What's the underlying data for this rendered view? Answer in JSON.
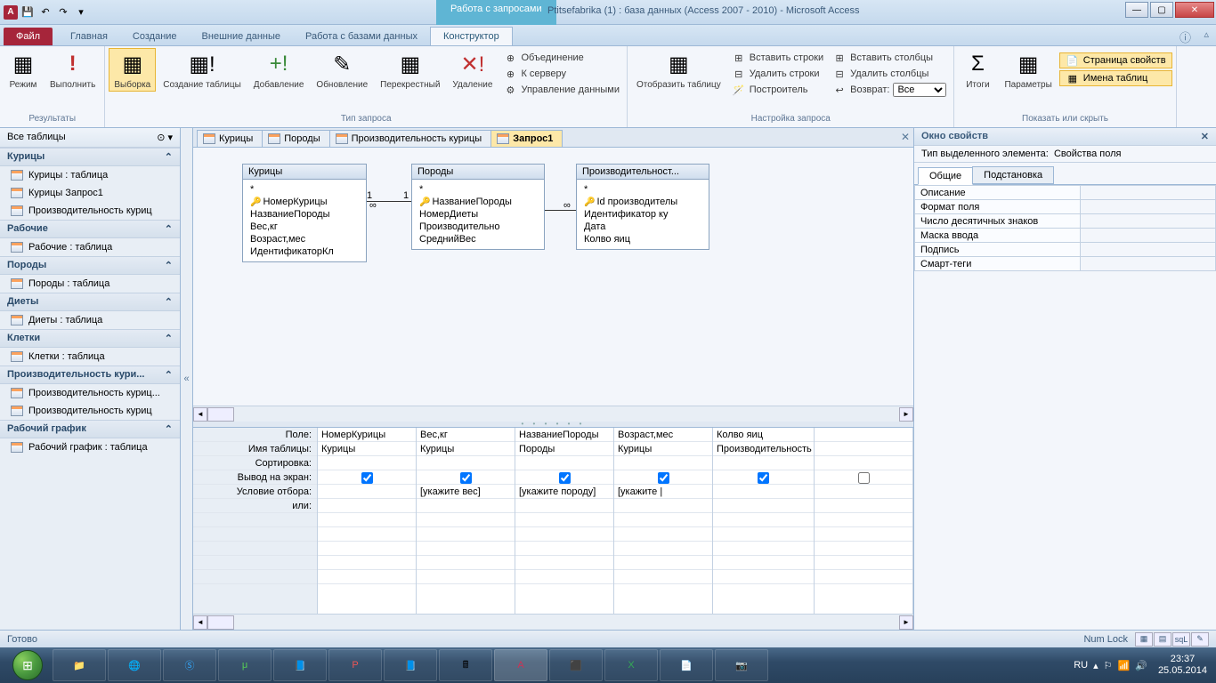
{
  "titlebar": {
    "context_tab": "Работа с запросами",
    "title": "Ptitsefabrika (1) : база данных (Access 2007 - 2010)  -  Microsoft Access",
    "app_letter": "A"
  },
  "ribbon_tabs": {
    "file": "Файл",
    "tabs": [
      "Главная",
      "Создание",
      "Внешние данные",
      "Работа с базами данных"
    ],
    "context": "Конструктор"
  },
  "ribbon": {
    "results": {
      "mode": "Режим",
      "run": "Выполнить",
      "label": "Результаты"
    },
    "qtype": {
      "select": "Выборка",
      "maketable": "Создание таблицы",
      "append": "Добавление",
      "update": "Обновление",
      "crosstab": "Перекрестный",
      "delete": "Удаление",
      "union": "Объединение",
      "passthrough": "К серверу",
      "ddl": "Управление данными",
      "label": "Тип запроса"
    },
    "setup": {
      "showtable": "Отобразить таблицу",
      "insrows": "Вставить строки",
      "delrows": "Удалить строки",
      "builder": "Построитель",
      "inscols": "Вставить столбцы",
      "delcols": "Удалить столбцы",
      "return": "Возврат:",
      "return_val": "Все",
      "label": "Настройка запроса"
    },
    "showhide": {
      "totals": "Итоги",
      "params": "Параметры",
      "propsheet": "Страница свойств",
      "tablenames": "Имена таблиц",
      "label": "Показать или скрыть"
    }
  },
  "nav": {
    "header": "Все таблицы",
    "groups": [
      {
        "title": "Курицы",
        "items": [
          "Курицы : таблица",
          "Курицы Запрос1",
          "Производительность куриц"
        ]
      },
      {
        "title": "Рабочие",
        "items": [
          "Рабочие : таблица"
        ]
      },
      {
        "title": "Породы",
        "items": [
          "Породы : таблица"
        ]
      },
      {
        "title": "Диеты",
        "items": [
          "Диеты : таблица"
        ]
      },
      {
        "title": "Клетки",
        "items": [
          "Клетки : таблица"
        ]
      },
      {
        "title": "Производительность кури...",
        "items": [
          "Производительность куриц...",
          "Производительность куриц"
        ]
      },
      {
        "title": "Рабочий график",
        "items": [
          "Рабочий график : таблица"
        ]
      }
    ]
  },
  "doc_tabs": [
    "Курицы",
    "Породы",
    "Производительность курицы",
    "Запрос1"
  ],
  "tables": {
    "t1": {
      "title": "Курицы",
      "star": "*",
      "fields": [
        "НомерКурицы",
        "НазваниеПороды",
        "Вес,кг",
        "Возраст,мес",
        "ИдентификаторКл"
      ],
      "key": 0
    },
    "t2": {
      "title": "Породы",
      "star": "*",
      "fields": [
        "НазваниеПороды",
        "НомерДиеты",
        "Производительно",
        "СреднийВес"
      ],
      "key": 0
    },
    "t3": {
      "title": "Производительност...",
      "star": "*",
      "fields": [
        "Id производителы",
        "Идентификатор ку",
        "Дата",
        "Колво яиц"
      ],
      "key": 0
    }
  },
  "rel": {
    "one": "1",
    "many": "∞"
  },
  "grid": {
    "labels": [
      "Поле:",
      "Имя таблицы:",
      "Сортировка:",
      "Вывод на экран:",
      "Условие отбора:",
      "или:"
    ],
    "cols": [
      {
        "field": "НомерКурицы",
        "table": "Курицы",
        "show": true,
        "criteria": ""
      },
      {
        "field": "Вес,кг",
        "table": "Курицы",
        "show": true,
        "criteria": "[укажите вес]"
      },
      {
        "field": "НазваниеПороды",
        "table": "Породы",
        "show": true,
        "criteria": "[укажите породу]"
      },
      {
        "field": "Возраст,мес",
        "table": "Курицы",
        "show": true,
        "criteria": "[укажите |"
      },
      {
        "field": "Колво яиц",
        "table": "Производительность",
        "show": true,
        "criteria": ""
      },
      {
        "field": "",
        "table": "",
        "show": false,
        "criteria": ""
      }
    ]
  },
  "props": {
    "title": "Окно свойств",
    "subtitle_label": "Тип выделенного элемента:",
    "subtitle_value": "Свойства поля",
    "tabs": [
      "Общие",
      "Подстановка"
    ],
    "rows": [
      "Описание",
      "Формат поля",
      "Число десятичных знаков",
      "Маска ввода",
      "Подпись",
      "Смарт-теги"
    ]
  },
  "status": {
    "ready": "Готово",
    "numlock": "Num Lock"
  },
  "tray": {
    "lang": "RU",
    "time": "23:37",
    "date": "25.05.2014"
  }
}
